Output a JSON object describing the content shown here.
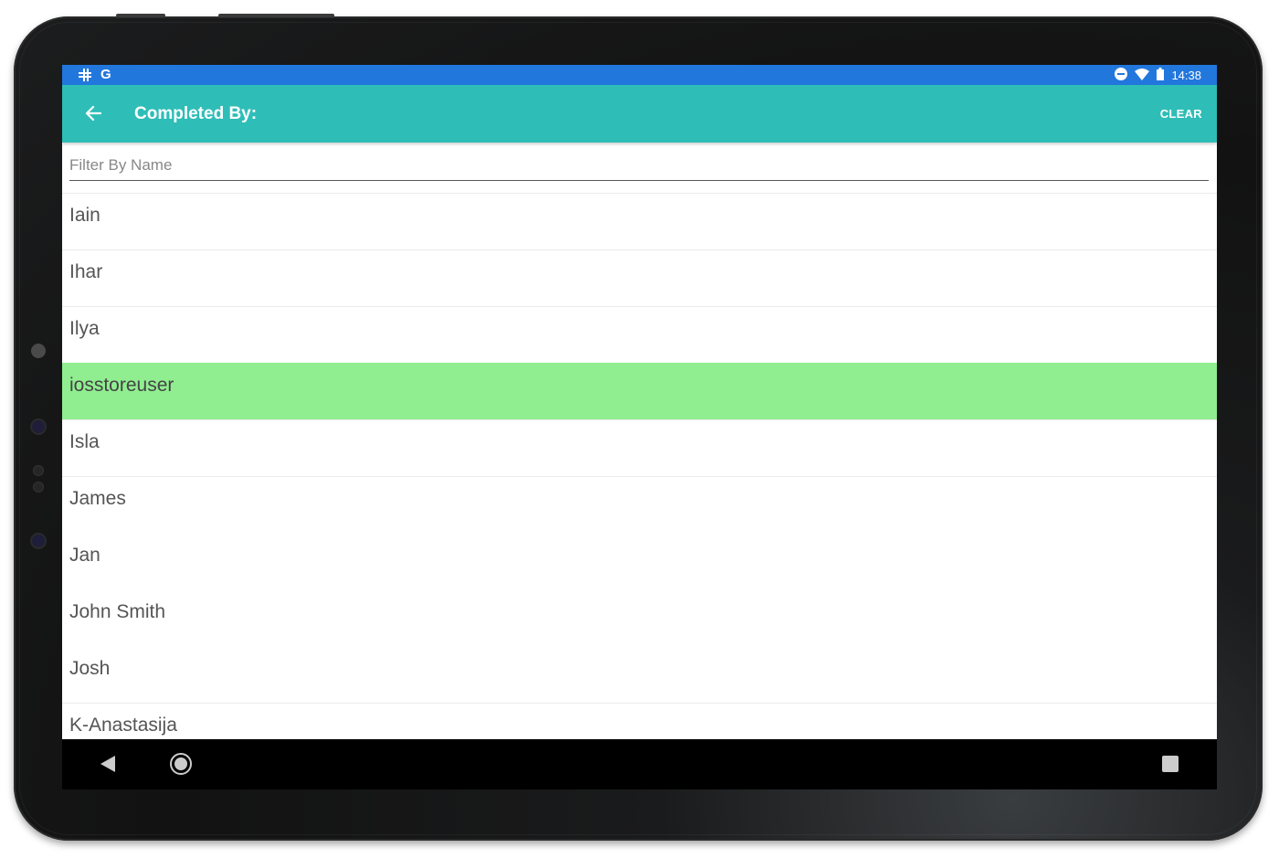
{
  "status_bar": {
    "left_icons": [
      "slack-icon",
      "google-icon"
    ],
    "google_glyph": "G",
    "time": "14:38",
    "right_icons": [
      "do-not-disturb-icon",
      "wifi-icon",
      "battery-icon"
    ]
  },
  "app_bar": {
    "title": "Completed By:",
    "back_icon": "arrow-left-icon",
    "clear_label": "CLEAR"
  },
  "filter": {
    "placeholder": "Filter By Name",
    "value": ""
  },
  "list": {
    "items": [
      {
        "label": "Iain",
        "selected": false
      },
      {
        "label": "Ihar",
        "selected": false
      },
      {
        "label": "Ilya",
        "selected": false
      },
      {
        "label": "iosstoreuser",
        "selected": true
      },
      {
        "label": "Isla",
        "selected": false
      },
      {
        "label": "James",
        "selected": false
      },
      {
        "label": "Jan",
        "selected": false
      },
      {
        "label": "John Smith",
        "selected": false
      },
      {
        "label": "Josh",
        "selected": false
      },
      {
        "label": "K-Anastasija",
        "selected": false
      }
    ]
  },
  "nav_bar": {
    "icons": [
      "back-triangle-icon",
      "home-circle-icon",
      "recents-square-icon"
    ]
  },
  "colors": {
    "status_bar": "#2277dd",
    "app_bar": "#2fbdb7",
    "selected_row": "#90ee90"
  }
}
